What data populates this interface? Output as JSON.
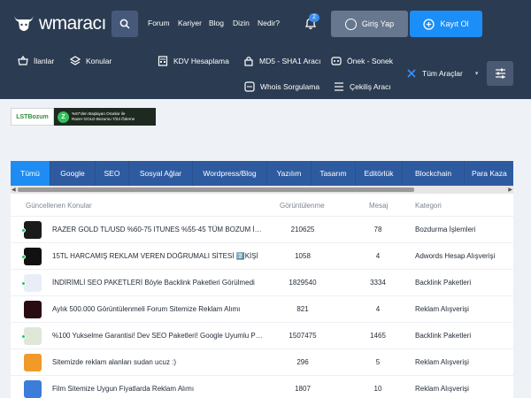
{
  "header": {
    "logo_text": "wmaracı",
    "nav": [
      "Forum",
      "Kariyer",
      "Blog",
      "Dizin",
      "Nedir?"
    ],
    "notification_count": "2",
    "login_label": "Giriş Yap",
    "register_label": "Kayıt Ol"
  },
  "toolbar": {
    "items": [
      "İlanlar",
      "Konular",
      "KDV Hesaplama",
      "MD5 - SHA1 Aracı",
      "Önek - Sonek",
      "Whois Sorgulama",
      "Çekiliş Aracı"
    ],
    "all_tools_label": "Tüm Araçlar"
  },
  "banner": {
    "left_text": "LSTBozum",
    "right_line1": "%67'den Başlayan Oranlar ile",
    "right_line2": "Razer GOLD Bozumu 7/24 Ödeme"
  },
  "tabs": [
    "Tümü",
    "Google",
    "SEO",
    "Sosyal Ağlar",
    "Wordpress/Blog",
    "Yazılım",
    "Tasarım",
    "Editörlük",
    "Blockchain",
    "Para Kaza"
  ],
  "table": {
    "headers": [
      "Güncellenen Konular",
      "Görüntülenme",
      "Mesaj",
      "Kategori"
    ],
    "rows": [
      {
        "title": "RAZER GOLD TL/USD %60-75 ITUNES %55-45 TÜM BOZUM İŞLEMLERİ",
        "views": "210625",
        "messages": "78",
        "category": "Bozdurma İşlemleri",
        "avatar_color": "#1b1b1b",
        "online": true
      },
      {
        "title": "15TL HARCAMIŞ REKLAM VEREN DOĞRUMALI SİTESİ 2️⃣KİŞİ",
        "views": "1058",
        "messages": "4",
        "category": "Adwords Hesap Alışverişi",
        "avatar_color": "#111111",
        "online": true
      },
      {
        "title": "İNDİRİMLİ SEO PAKETLERİ Böyle Backlink Paketleri Görülmedi",
        "views": "1829540",
        "messages": "3334",
        "category": "Backlink Paketleri",
        "avatar_color": "#e8eef7",
        "online": true
      },
      {
        "title": "Aylık 500.000 Görüntülenmeli Forum Sitemize Reklam Alımı",
        "views": "821",
        "messages": "4",
        "category": "Reklam Alışverişi",
        "avatar_color": "#2a0d12",
        "online": false
      },
      {
        "title": "%100 Yukselme Garantisi! Dev SEO Paketleri! Google Uyumlu Paketler",
        "views": "1507475",
        "messages": "1465",
        "category": "Backlink Paketleri",
        "avatar_color": "#dfe7d8",
        "online": true
      },
      {
        "title": "Sitemizde reklam alanları sudan ucuz :)",
        "views": "296",
        "messages": "5",
        "category": "Reklam Alışverişi",
        "avatar_color": "#f09a2a",
        "online": false
      },
      {
        "title": "Film Sitemize Uygun Fiyatlarda Reklam Alımı",
        "views": "1807",
        "messages": "10",
        "category": "Reklam Alışverişi",
        "avatar_color": "#3b7dd8",
        "online": false
      }
    ]
  },
  "colors": {
    "header_bg": "#2b3c52",
    "accent": "#1b8ef8",
    "tab_bar": "#2e5ba0"
  }
}
